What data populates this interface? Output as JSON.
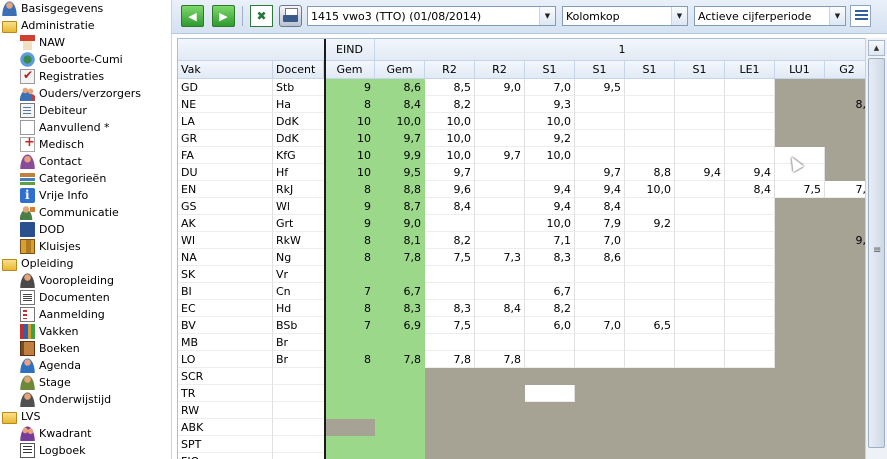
{
  "sidebar": {
    "items": [
      {
        "label": "Basisgegevens",
        "icon": "basis-icon",
        "cls": "ico-person",
        "level": 0
      },
      {
        "label": "Administratie",
        "icon": "folder-icon",
        "cls": "ico-folder",
        "level": 0
      },
      {
        "label": "NAW",
        "icon": "house-icon",
        "cls": "ico-house",
        "level": 1
      },
      {
        "label": "Geboorte-Cumi",
        "icon": "globe-icon",
        "cls": "ico-globe",
        "level": 1
      },
      {
        "label": "Registraties",
        "icon": "checklist-icon",
        "cls": "ico-check",
        "level": 1
      },
      {
        "label": "Ouders/verzorgers",
        "icon": "parents-icon",
        "cls": "ico-people",
        "level": 1
      },
      {
        "label": "Debiteur",
        "icon": "ledger-icon",
        "cls": "ico-ledger",
        "level": 1
      },
      {
        "label": "Aanvullend *",
        "icon": "document-icon",
        "cls": "ico-doc",
        "level": 1
      },
      {
        "label": "Medisch",
        "icon": "medical-icon",
        "cls": "ico-cross",
        "level": 1
      },
      {
        "label": "Contact",
        "icon": "contact-icon",
        "cls": "ico-contact",
        "level": 1
      },
      {
        "label": "Categorieën",
        "icon": "categories-icon",
        "cls": "ico-cats",
        "level": 1
      },
      {
        "label": "Vrije Info",
        "icon": "info-icon",
        "cls": "ico-info",
        "level": 1
      },
      {
        "label": "Communicatie",
        "icon": "communication-icon",
        "cls": "ico-comm",
        "level": 1
      },
      {
        "label": "DOD",
        "icon": "dod-icon",
        "cls": "ico-dod",
        "level": 1
      },
      {
        "label": "Kluisjes",
        "icon": "locker-icon",
        "cls": "ico-locker",
        "level": 1
      },
      {
        "label": "Opleiding",
        "icon": "folder-icon",
        "cls": "ico-folder",
        "level": 0
      },
      {
        "label": "Vooropleiding",
        "icon": "school-icon",
        "cls": "ico-school",
        "level": 1
      },
      {
        "label": "Documenten",
        "icon": "documents-icon",
        "cls": "ico-docs",
        "level": 1
      },
      {
        "label": "Aanmelding",
        "icon": "form-icon",
        "cls": "ico-form",
        "level": 1
      },
      {
        "label": "Vakken",
        "icon": "books-icon",
        "cls": "ico-books",
        "level": 1
      },
      {
        "label": "Boeken",
        "icon": "book-icon",
        "cls": "ico-book",
        "level": 1
      },
      {
        "label": "Agenda",
        "icon": "agenda-icon",
        "cls": "ico-agenda",
        "level": 1
      },
      {
        "label": "Stage",
        "icon": "stage-icon",
        "cls": "ico-stage",
        "level": 1
      },
      {
        "label": "Onderwijstijd",
        "icon": "time-icon",
        "cls": "ico-time",
        "level": 1
      },
      {
        "label": "LVS",
        "icon": "folder-icon",
        "cls": "ico-folder",
        "level": 0
      },
      {
        "label": "Kwadrant",
        "icon": "quadrant-icon",
        "cls": "ico-quad",
        "level": 1
      },
      {
        "label": "Logboek",
        "icon": "logbook-icon",
        "cls": "ico-log",
        "level": 1
      }
    ]
  },
  "toolbar": {
    "class_select": "1415 vwo3 (TTO) (01/08/2014)",
    "layout_select": "Kolomkop",
    "period_select": "Actieve cijferperiode"
  },
  "grid": {
    "group_headers": {
      "eind": "EIND",
      "period": "1"
    },
    "headers": [
      "Vak",
      "Docent",
      "Gem",
      "Gem",
      "R2",
      "R2",
      "S1",
      "S1",
      "S1",
      "S1",
      "LE1",
      "LU1",
      "G2"
    ],
    "colors": {
      "green": "#9cd88a",
      "gray": "#a6a395",
      "header": "#e8eef7"
    },
    "rows": [
      {
        "vak": "GD",
        "docent": "Stb",
        "vals": [
          "9",
          "8,6",
          "8,5",
          "9,0",
          "7,0",
          "9,5",
          "",
          "",
          "",
          "",
          ""
        ],
        "gray": [
          9,
          10
        ]
      },
      {
        "vak": "NE",
        "docent": "Ha",
        "vals": [
          "8",
          "8,4",
          "8,2",
          "",
          "9,3",
          "",
          "",
          "",
          "",
          "",
          "8,"
        ],
        "gray": [
          9,
          10
        ]
      },
      {
        "vak": "LA",
        "docent": "DdK",
        "vals": [
          "10",
          "10,0",
          "10,0",
          "",
          "10,0",
          "",
          "",
          "",
          "",
          "",
          ""
        ],
        "gray": [
          9,
          10
        ]
      },
      {
        "vak": "GR",
        "docent": "DdK",
        "vals": [
          "10",
          "9,7",
          "10,0",
          "",
          "9,2",
          "",
          "",
          "",
          "",
          "",
          ""
        ],
        "gray": [
          9,
          10
        ]
      },
      {
        "vak": "FA",
        "docent": "KfG",
        "vals": [
          "10",
          "9,9",
          "10,0",
          "9,7",
          "10,0",
          "",
          "",
          "",
          "",
          "",
          ""
        ],
        "gray": [
          10
        ]
      },
      {
        "vak": "DU",
        "docent": "Hf",
        "vals": [
          "10",
          "9,5",
          "9,7",
          "",
          "",
          "9,7",
          "8,8",
          "9,4",
          "9,4",
          "",
          ""
        ],
        "gray": [
          10
        ]
      },
      {
        "vak": "EN",
        "docent": "RkJ",
        "vals": [
          "8",
          "8,8",
          "9,6",
          "",
          "9,4",
          "9,4",
          "10,0",
          "",
          "8,4",
          "7,5",
          "7,"
        ],
        "gray": []
      },
      {
        "vak": "GS",
        "docent": "Wl",
        "vals": [
          "9",
          "8,7",
          "8,4",
          "",
          "9,4",
          "8,4",
          "",
          "",
          "",
          "",
          ""
        ],
        "gray": [
          9,
          10
        ]
      },
      {
        "vak": "AK",
        "docent": "Grt",
        "vals": [
          "9",
          "9,0",
          "",
          "",
          "10,0",
          "7,9",
          "9,2",
          "",
          "",
          "",
          ""
        ],
        "gray": [
          9,
          10
        ]
      },
      {
        "vak": "WI",
        "docent": "RkW",
        "vals": [
          "8",
          "8,1",
          "8,2",
          "",
          "7,1",
          "7,0",
          "",
          "",
          "",
          "",
          "9,"
        ],
        "gray": [
          9,
          10
        ]
      },
      {
        "vak": "NA",
        "docent": "Ng",
        "vals": [
          "8",
          "7,8",
          "7,5",
          "7,3",
          "8,3",
          "8,6",
          "",
          "",
          "",
          "",
          ""
        ],
        "gray": [
          9,
          10
        ]
      },
      {
        "vak": "SK",
        "docent": "Vr",
        "vals": [
          "",
          "",
          "",
          "",
          "",
          "",
          "",
          "",
          "",
          "",
          ""
        ],
        "gray": [
          9,
          10
        ]
      },
      {
        "vak": "BI",
        "docent": "Cn",
        "vals": [
          "7",
          "6,7",
          "",
          "",
          "6,7",
          "",
          "",
          "",
          "",
          "",
          ""
        ],
        "gray": [
          9,
          10
        ]
      },
      {
        "vak": "EC",
        "docent": "Hd",
        "vals": [
          "8",
          "8,3",
          "8,3",
          "8,4",
          "8,2",
          "",
          "",
          "",
          "",
          "",
          ""
        ],
        "gray": [
          9,
          10
        ]
      },
      {
        "vak": "BV",
        "docent": "BSb",
        "vals": [
          "7",
          "6,9",
          "7,5",
          "",
          "6,0",
          "7,0",
          "6,5",
          "",
          "",
          "",
          ""
        ],
        "gray": [
          9,
          10
        ]
      },
      {
        "vak": "MB",
        "docent": "Br",
        "vals": [
          "",
          "",
          "",
          "",
          "",
          "",
          "",
          "",
          "",
          "",
          ""
        ],
        "gray": [
          9,
          10
        ]
      },
      {
        "vak": "LO",
        "docent": "Br",
        "vals": [
          "8",
          "7,8",
          "7,8",
          "7,8",
          "",
          "",
          "",
          "",
          "",
          "",
          ""
        ],
        "gray": [
          9,
          10
        ]
      },
      {
        "vak": "SCR",
        "docent": "",
        "vals": [
          "",
          "",
          "",
          "",
          "",
          "",
          "",
          "",
          "",
          "",
          ""
        ],
        "gray": [
          2,
          3,
          4,
          5,
          6,
          7,
          8,
          9,
          10
        ]
      },
      {
        "vak": "TR",
        "docent": "",
        "vals": [
          "",
          "",
          "",
          "",
          "",
          "",
          "",
          "",
          "",
          "",
          ""
        ],
        "gray": [
          2,
          3,
          5,
          6,
          7,
          8,
          9,
          10
        ]
      },
      {
        "vak": "RW",
        "docent": "",
        "vals": [
          "",
          "",
          "",
          "",
          "",
          "",
          "",
          "",
          "",
          "",
          ""
        ],
        "gray": [
          2,
          3,
          4,
          5,
          6,
          7,
          8,
          9,
          10
        ]
      },
      {
        "vak": "ABK",
        "docent": "",
        "vals": [
          "",
          "",
          "",
          "",
          "",
          "",
          "",
          "",
          "",
          "",
          ""
        ],
        "gray": [
          0,
          2,
          3,
          4,
          5,
          6,
          7,
          8,
          9,
          10
        ]
      },
      {
        "vak": "SPT",
        "docent": "",
        "vals": [
          "",
          "",
          "",
          "",
          "",
          "",
          "",
          "",
          "",
          "",
          ""
        ],
        "gray": [
          2,
          3,
          4,
          5,
          6,
          7,
          8,
          9,
          10
        ]
      },
      {
        "vak": "FIO",
        "docent": "",
        "vals": [
          "",
          "",
          "",
          "",
          "",
          "",
          "",
          "",
          "",
          "",
          ""
        ],
        "gray": [
          2,
          3,
          4,
          5,
          6,
          7,
          8,
          9,
          10
        ]
      }
    ]
  }
}
